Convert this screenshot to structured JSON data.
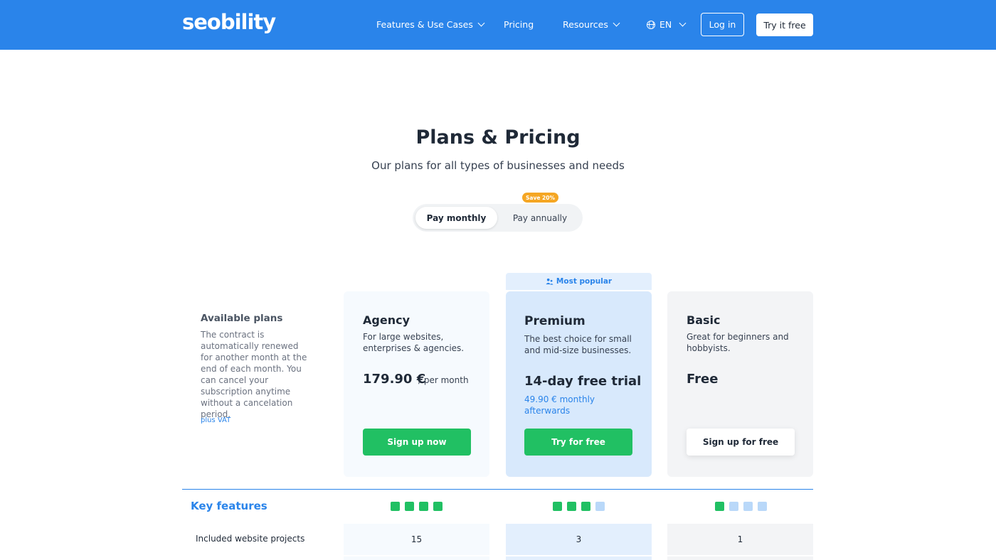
{
  "header": {
    "logo": "seobility",
    "nav": {
      "features": "Features & Use Cases",
      "pricing": "Pricing",
      "resources": "Resources",
      "language": "EN"
    },
    "login": "Log in",
    "try_free": "Try it free",
    "colors": {
      "bar": "#2a84ea"
    }
  },
  "hero": {
    "title": "Plans & Pricing",
    "subtitle": "Our plans for all types of businesses and needs"
  },
  "billing_toggle": {
    "monthly": "Pay monthly",
    "annually": "Pay annually",
    "save_badge": "Save 20%",
    "selected": "Pay monthly"
  },
  "info": {
    "title": "Available plans",
    "text": "The contract is automatically renewed for another month at the end of each month. You can cancel your subscription anytime without a cancelation period.",
    "vat_link": "plus VAT"
  },
  "plans": {
    "agency": {
      "name": "Agency",
      "description": "For large websites, enterprises & agencies.",
      "price": "179.90 €",
      "price_suffix": "/ per month",
      "cta": "Sign up now"
    },
    "premium": {
      "badge": "Most popular",
      "name": "Premium",
      "description": "The best choice for small and mid-size businesses.",
      "price": "14-day free trial",
      "after_note": "49.90 € monthly afterwards",
      "cta": "Try for free"
    },
    "basic": {
      "name": "Basic",
      "description": "Great for beginners and hobbyists.",
      "price": "Free",
      "cta": "Sign up for free"
    }
  },
  "features": {
    "heading": "Key features",
    "ratings": {
      "agency": 4,
      "premium": 3,
      "basic": 1
    },
    "rating_max": 4,
    "rows": [
      {
        "label": "Included website projects",
        "agency": "15",
        "premium": "3",
        "basic": "1"
      }
    ]
  },
  "colors": {
    "accent": "#2a84ea",
    "green": "#21c063",
    "badge": "#f5a623"
  }
}
